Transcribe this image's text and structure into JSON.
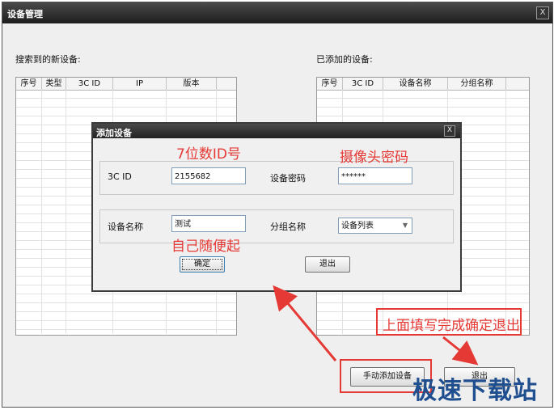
{
  "window": {
    "title": "设备管理",
    "close_glyph": "X"
  },
  "left_panel": {
    "label": "搜索到的新设备:",
    "columns": [
      "序号",
      "类型",
      "3C ID",
      "IP",
      "版本"
    ]
  },
  "right_panel": {
    "label": "已添加的设备:",
    "columns": [
      "序号",
      "3C ID",
      "设备名称",
      "分组名称"
    ]
  },
  "dialog": {
    "title": "添加设备",
    "close_glyph": "X",
    "id_label": "3C ID",
    "id_value": "2155682",
    "password_label": "设备密码",
    "password_value": "******",
    "name_label": "设备名称",
    "name_value": "测试",
    "group_label": "分组名称",
    "group_value": "设备列表",
    "confirm_label": "确定",
    "exit_label": "退出"
  },
  "buttons": {
    "manual_add": "手动添加设备",
    "exit": "退出"
  },
  "annotations": {
    "id_hint": "7位数ID号",
    "password_hint": "摄像头密码",
    "name_hint": "自己随便起",
    "exit_hint": "上面填写完成确定退出"
  },
  "watermark": "极速下载站",
  "colors": {
    "annotation_red": "#e53935",
    "titlebar": "#1d1d1d"
  }
}
